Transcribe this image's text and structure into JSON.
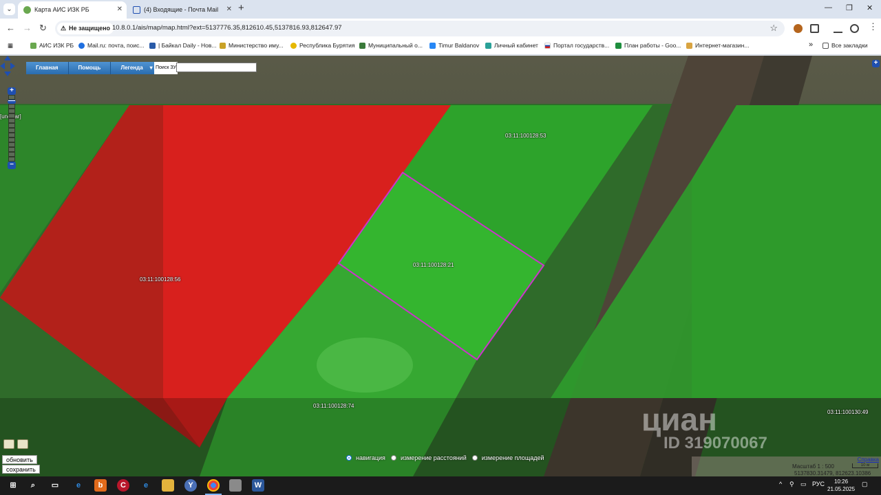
{
  "browser": {
    "tabs": [
      {
        "title": "Карта АИС ИЗК РБ",
        "active": true
      },
      {
        "title": "(4) Входящие - Почта Mail",
        "active": false
      }
    ],
    "security_label": "Не защищено",
    "url": "10.8.0.1/ais/map/map.html?ext=5137776.35,812610.45,5137816.93,812647.97",
    "bookmarks": [
      "АИС ИЗК РБ",
      "Mail.ru: почта, поис...",
      "| Байкал Daily - Нов...",
      "Министерство иму...",
      "Республика Бурятия",
      "Муниципальный о...",
      "Timur Baldanov",
      "Личный кабинет",
      "Портал государств...",
      "План работы - Goo...",
      "Интернет-магазин..."
    ],
    "all_bookmarks": "Все закладки"
  },
  "map": {
    "menu": [
      "Главная",
      "Помощь",
      "Легенда"
    ],
    "search_label": "Поиск ЗУ",
    "search_value": "",
    "parcels": [
      {
        "label": "03:11:100128:56",
        "color": "#d8201d"
      },
      {
        "label": "03:11:100128:53",
        "color": "#2da32b"
      },
      {
        "label": "03:11:100128:21",
        "color": "#2da32b"
      },
      {
        "label": "03:11:100128:74",
        "color": "#2da32b"
      },
      {
        "label": "03:11:100130:49",
        "color": "#2da32b"
      },
      {
        "label": "[unclear]",
        "color": "#2da32b"
      }
    ],
    "selected_outline_color": "#cc33cc",
    "actions": {
      "refresh": "обновить",
      "save": "сохранить"
    },
    "modes": [
      {
        "label": "навигация",
        "selected": true
      },
      {
        "label": "измерение расстояний",
        "selected": false
      },
      {
        "label": "измерение площадей",
        "selected": false
      }
    ],
    "watermark": {
      "brand": "циан",
      "id": "ID 319070067"
    },
    "scale": {
      "link": "Справка",
      "text": "Масштаб 1 : 500",
      "bar_label": "10 м",
      "coords": "5137830.31479, 812623.10386"
    }
  },
  "taskbar": {
    "language": "РУС",
    "time": "10:26",
    "date": "21.05.2025"
  }
}
